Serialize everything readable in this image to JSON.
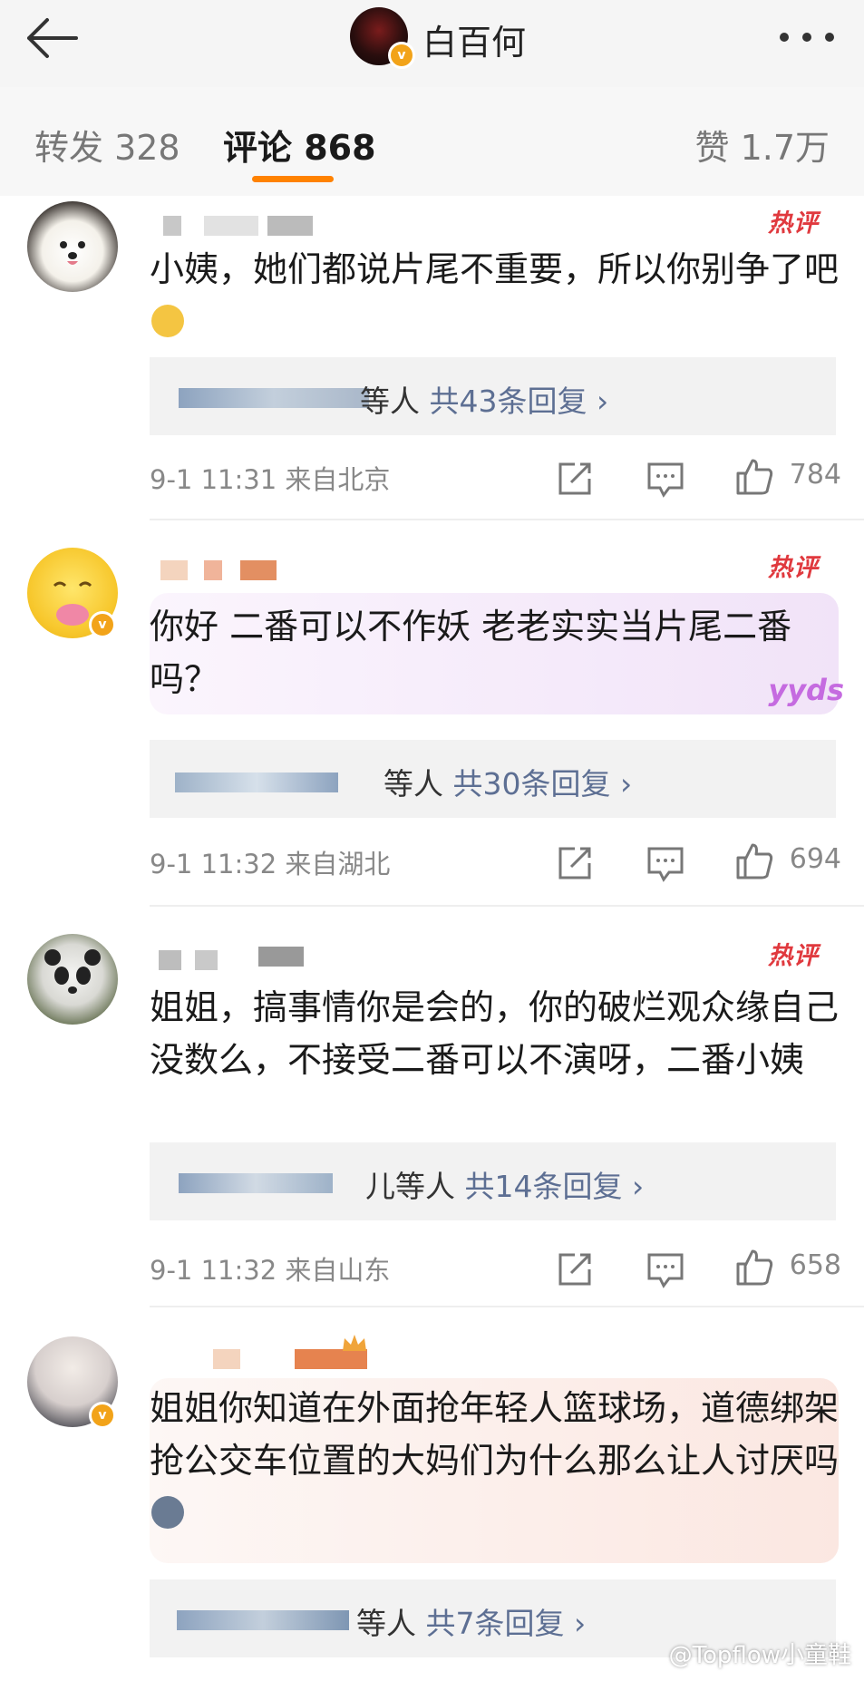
{
  "header": {
    "title": "白百何",
    "verified_badge": "v"
  },
  "tabs": [
    {
      "label": "转发 328"
    },
    {
      "label": "评论 868"
    },
    {
      "label": "赞 1.7万"
    }
  ],
  "hot_tag": "热评",
  "comments": [
    {
      "text": "小姨，她们都说片尾不重要，所以你别争了吧",
      "reply_prefix": "等人",
      "reply_count": "共43条回复 ›",
      "time": "9-1 11:31",
      "location": "来自北京",
      "likes": "784"
    },
    {
      "text": "你好 二番可以不作妖 老老实实当片尾二番吗？",
      "reply_prefix": "等人",
      "reply_count": "共30条回复 ›",
      "time": "9-1 11:32",
      "location": "来自湖北",
      "likes": "694",
      "sticker_text": "yyds"
    },
    {
      "text": "姐姐，搞事情你是会的，你的破烂观众缘自己没数么，不接受二番可以不演呀，二番小姨",
      "reply_prefix": "儿等人",
      "reply_count": "共14条回复 ›",
      "time": "9-1 11:32",
      "location": "来自山东",
      "likes": "658"
    },
    {
      "text": "姐姐你知道在外面抢年轻人篮球场，道德绑架抢公交车位置的大妈们为什么那么让人讨厌吗",
      "reply_prefix": "等人",
      "reply_count": "共7条回复 ›",
      "time": "",
      "location": "",
      "likes": ""
    }
  ],
  "watermark": "@Topflow小童鞋",
  "colors": {
    "accent": "#ff8200",
    "hot": "#e0393e",
    "link": "#5d6f93",
    "verified": "#f2a319"
  }
}
